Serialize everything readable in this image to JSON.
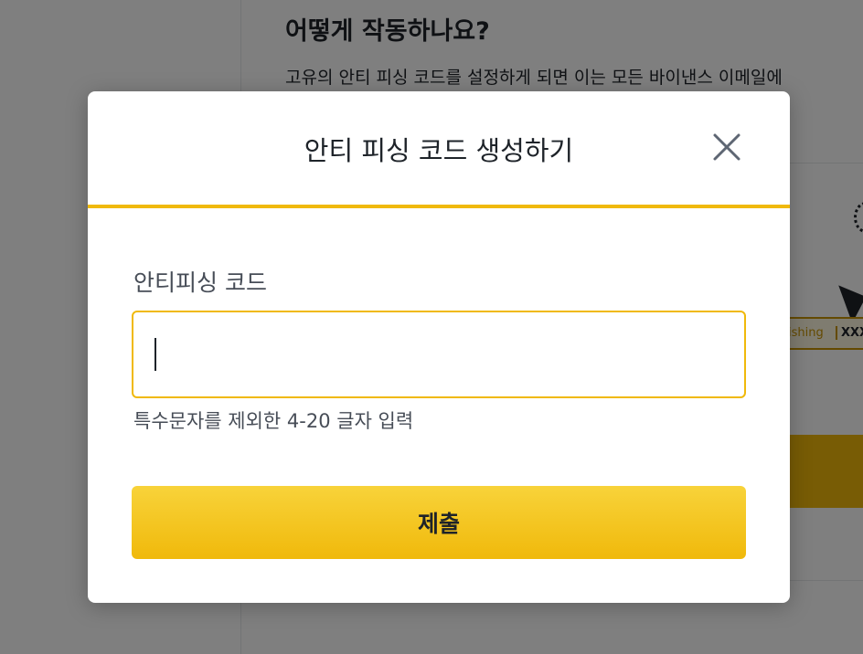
{
  "background": {
    "heading": "어떻게 작동하나요?",
    "description": "고유의 안티 피싱 코드를 설정하게 되면 이는 모든 바이낸스 이메일에",
    "illustration": {
      "code_label_left": "ishing",
      "code_label_right": "XXXX"
    }
  },
  "modal": {
    "title": "안티 피싱 코드 생성하기",
    "close_icon": "close-icon",
    "field_label": "안티피싱 코드",
    "input_value": "",
    "input_placeholder": "",
    "helper_text": "특수문자를 제외한 4-20 글자 입력",
    "submit_label": "제출"
  },
  "colors": {
    "accent": "#f0b90b",
    "text_primary": "#1e2329",
    "text_secondary": "#474d57",
    "overlay": "rgba(0,0,0,0.5)"
  }
}
